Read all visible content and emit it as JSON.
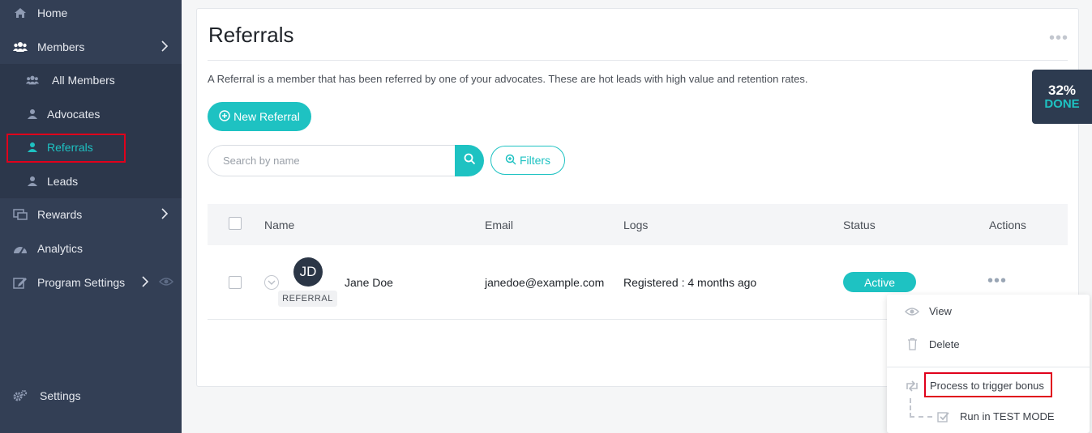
{
  "sidebar": {
    "items": [
      {
        "label": "Home",
        "icon": "home-icon"
      },
      {
        "label": "Members",
        "icon": "users-icon"
      },
      {
        "label": "Rewards",
        "icon": "rewards-icon"
      },
      {
        "label": "Analytics",
        "icon": "analytics-icon"
      },
      {
        "label": "Program Settings",
        "icon": "edit-icon"
      },
      {
        "label": "Settings",
        "icon": "cogs-icon"
      }
    ],
    "submenu": [
      {
        "label": "All Members",
        "icon": "users-icon"
      },
      {
        "label": "Advocates",
        "icon": "user-icon"
      },
      {
        "label": "Referrals",
        "icon": "user-icon",
        "active": true
      },
      {
        "label": "Leads",
        "icon": "user-icon"
      }
    ]
  },
  "page": {
    "title": "Referrals",
    "description": "A Referral is a member that has been referred by one of your advocates. These are hot leads with high value and retention rates.",
    "new_button": "New Referral",
    "search_placeholder": "Search by name",
    "filters_button": "Filters"
  },
  "progress": {
    "percent": "32%",
    "label": "DONE"
  },
  "table": {
    "columns": [
      "Name",
      "Email",
      "Logs",
      "Status",
      "Actions"
    ],
    "rows": [
      {
        "initials": "JD",
        "tag": "REFERRAL",
        "name": "Jane Doe",
        "email": "janedoe@example.com",
        "logs": "Registered : 4 months ago",
        "status": "Active"
      }
    ]
  },
  "actions_menu": {
    "view": "View",
    "delete": "Delete",
    "trigger": "Process to trigger bonus",
    "test_mode": "Run in TEST MODE"
  },
  "colors": {
    "accent": "#1ec2c2",
    "sidebar": "#333f55",
    "highlight": "#e0001b"
  }
}
